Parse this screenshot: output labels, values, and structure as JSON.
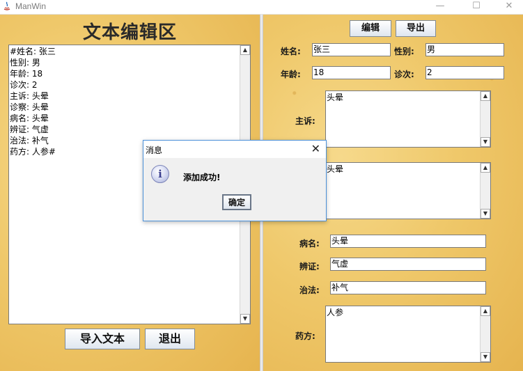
{
  "window": {
    "title": "ManWin",
    "minimize_glyph": "—",
    "maximize_glyph": "☐",
    "close_glyph": "✕"
  },
  "left": {
    "title": "文本编辑区",
    "editor_text": "#姓名: 张三\n性别: 男\n年龄: 18\n诊次: 2\n主诉: 头晕\n诊察: 头晕\n病名: 头晕\n辨证: 气虚\n治法: 补气\n药方: 人参#",
    "import_button": "导入文本",
    "exit_button": "退出"
  },
  "right": {
    "edit_button": "编辑",
    "export_button": "导出",
    "name": {
      "label": "姓名:",
      "value": "张三"
    },
    "gender": {
      "label": "性别:",
      "value": "男"
    },
    "age": {
      "label": "年龄:",
      "value": "18"
    },
    "visit": {
      "label": "诊次:",
      "value": "2"
    },
    "complaint": {
      "label": "主诉:",
      "value": "头晕"
    },
    "examination": {
      "value": "头晕"
    },
    "disease": {
      "label": "病名:",
      "value": "头晕"
    },
    "syndrome": {
      "label": "辨证:",
      "value": "气虚"
    },
    "therapy": {
      "label": "治法:",
      "value": "补气"
    },
    "prescription": {
      "label": "药方:",
      "value": "人参"
    }
  },
  "dialog": {
    "title": "消息",
    "close_glyph": "✕",
    "icon_glyph": "i",
    "message": "添加成功!",
    "ok_button": "确定"
  },
  "scroll_glyphs": {
    "up": "▲",
    "down": "▼"
  }
}
